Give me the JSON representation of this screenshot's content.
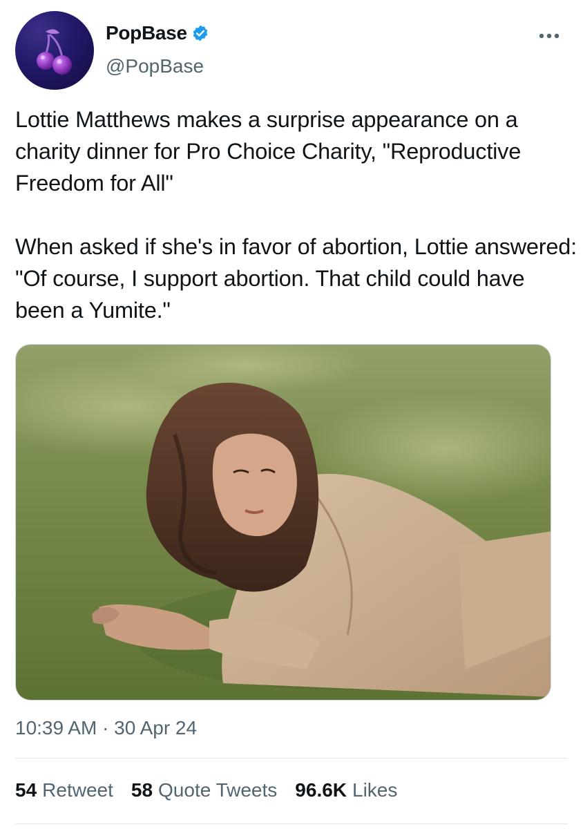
{
  "tweet": {
    "display_name": "PopBase",
    "handle": "@PopBase",
    "verified_icon": "verified-badge-icon",
    "more_icon": "more-options-icon",
    "text": "Lottie Matthews makes a surprise appearance on a charity dinner for Pro Choice Charity, \"Reproductive Freedom for All\"\n\nWhen asked if she's in favor of abortion, Lottie answered: \"Of course, I support abortion. That child could have been a Yumite.\"",
    "timestamp": "10:39 AM · 30 Apr 24",
    "stats": [
      {
        "count": "54",
        "label": "Retweet"
      },
      {
        "count": "58",
        "label": "Quote Tweets"
      },
      {
        "count": "96.6K",
        "label": "Likes"
      }
    ]
  },
  "colors": {
    "accent": "#1d9bf0",
    "secondary_text": "#536471",
    "primary_text": "#0f1419"
  }
}
